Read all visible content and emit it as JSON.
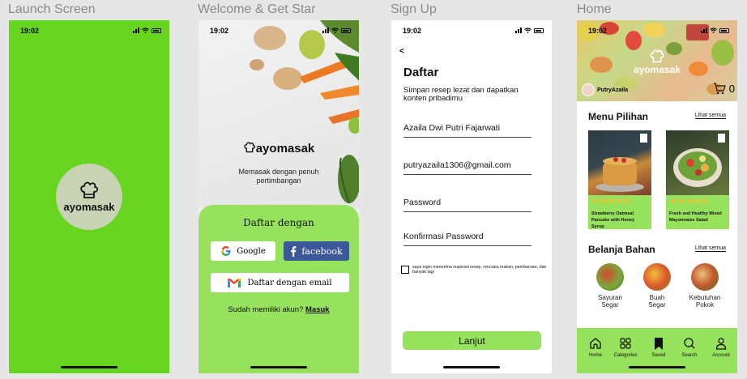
{
  "frames": {
    "launch": "Launch Screen",
    "welcome": "Welcome & Get Star",
    "signup": "Sign Up",
    "home": "Home"
  },
  "status": {
    "time": "19:02"
  },
  "launch": {
    "brand": "ayomasak"
  },
  "welcome": {
    "brand": "ayomasak",
    "tagline": "Memasak dengan penuh pertimbangan",
    "register_with": "Daftar dengan",
    "google_label": "Google",
    "facebook_label": "facebook",
    "email_label": "Daftar dengan email",
    "have_account": "Sudah memiliki akun?",
    "login_link": "Masuk"
  },
  "signup": {
    "back": "<",
    "title": "Daftar",
    "subtitle": "Simpan resep lezat dan dapatkan konten pribadimu",
    "name_value": "Azaila Dwi Putri Fajarwati",
    "email_value": "putryazaila1306@gmail.com",
    "password_placeholder": "Password",
    "confirm_placeholder": "Konfirmasi Password",
    "consent": "saya ingin  menerima inspirasi resep, rencana makan, pembaruan, dan banyak lagi",
    "next_button": "Lanjut"
  },
  "home": {
    "brand": "ayomasak",
    "username": "PutryAzaila",
    "cart_count": "0",
    "menu_title": "Menu Pilihan",
    "see_all": "Lihat semua",
    "recipes": [
      {
        "name": "Strawberry Oatmeal Pancake with Honey Syrup",
        "stars": "★★★★★"
      },
      {
        "name": "Fresh and Healthy Mixed Mayonnaise Salad",
        "stars": "★★★★★"
      }
    ],
    "shop_title": "Belanja Bahan",
    "categories": [
      {
        "line1": "Sayuran",
        "line2": "Segar"
      },
      {
        "line1": "Buah",
        "line2": "Segar"
      },
      {
        "line1": "Kebutuhan",
        "line2": "Pokok"
      }
    ],
    "tabs": [
      "Home",
      "Categories",
      "Saved",
      "Search",
      "Account"
    ]
  },
  "colors": {
    "launch_bg": "#67d51f",
    "accent_green": "#97e25d",
    "facebook_blue": "#3b5998",
    "star": "#f2c230"
  }
}
